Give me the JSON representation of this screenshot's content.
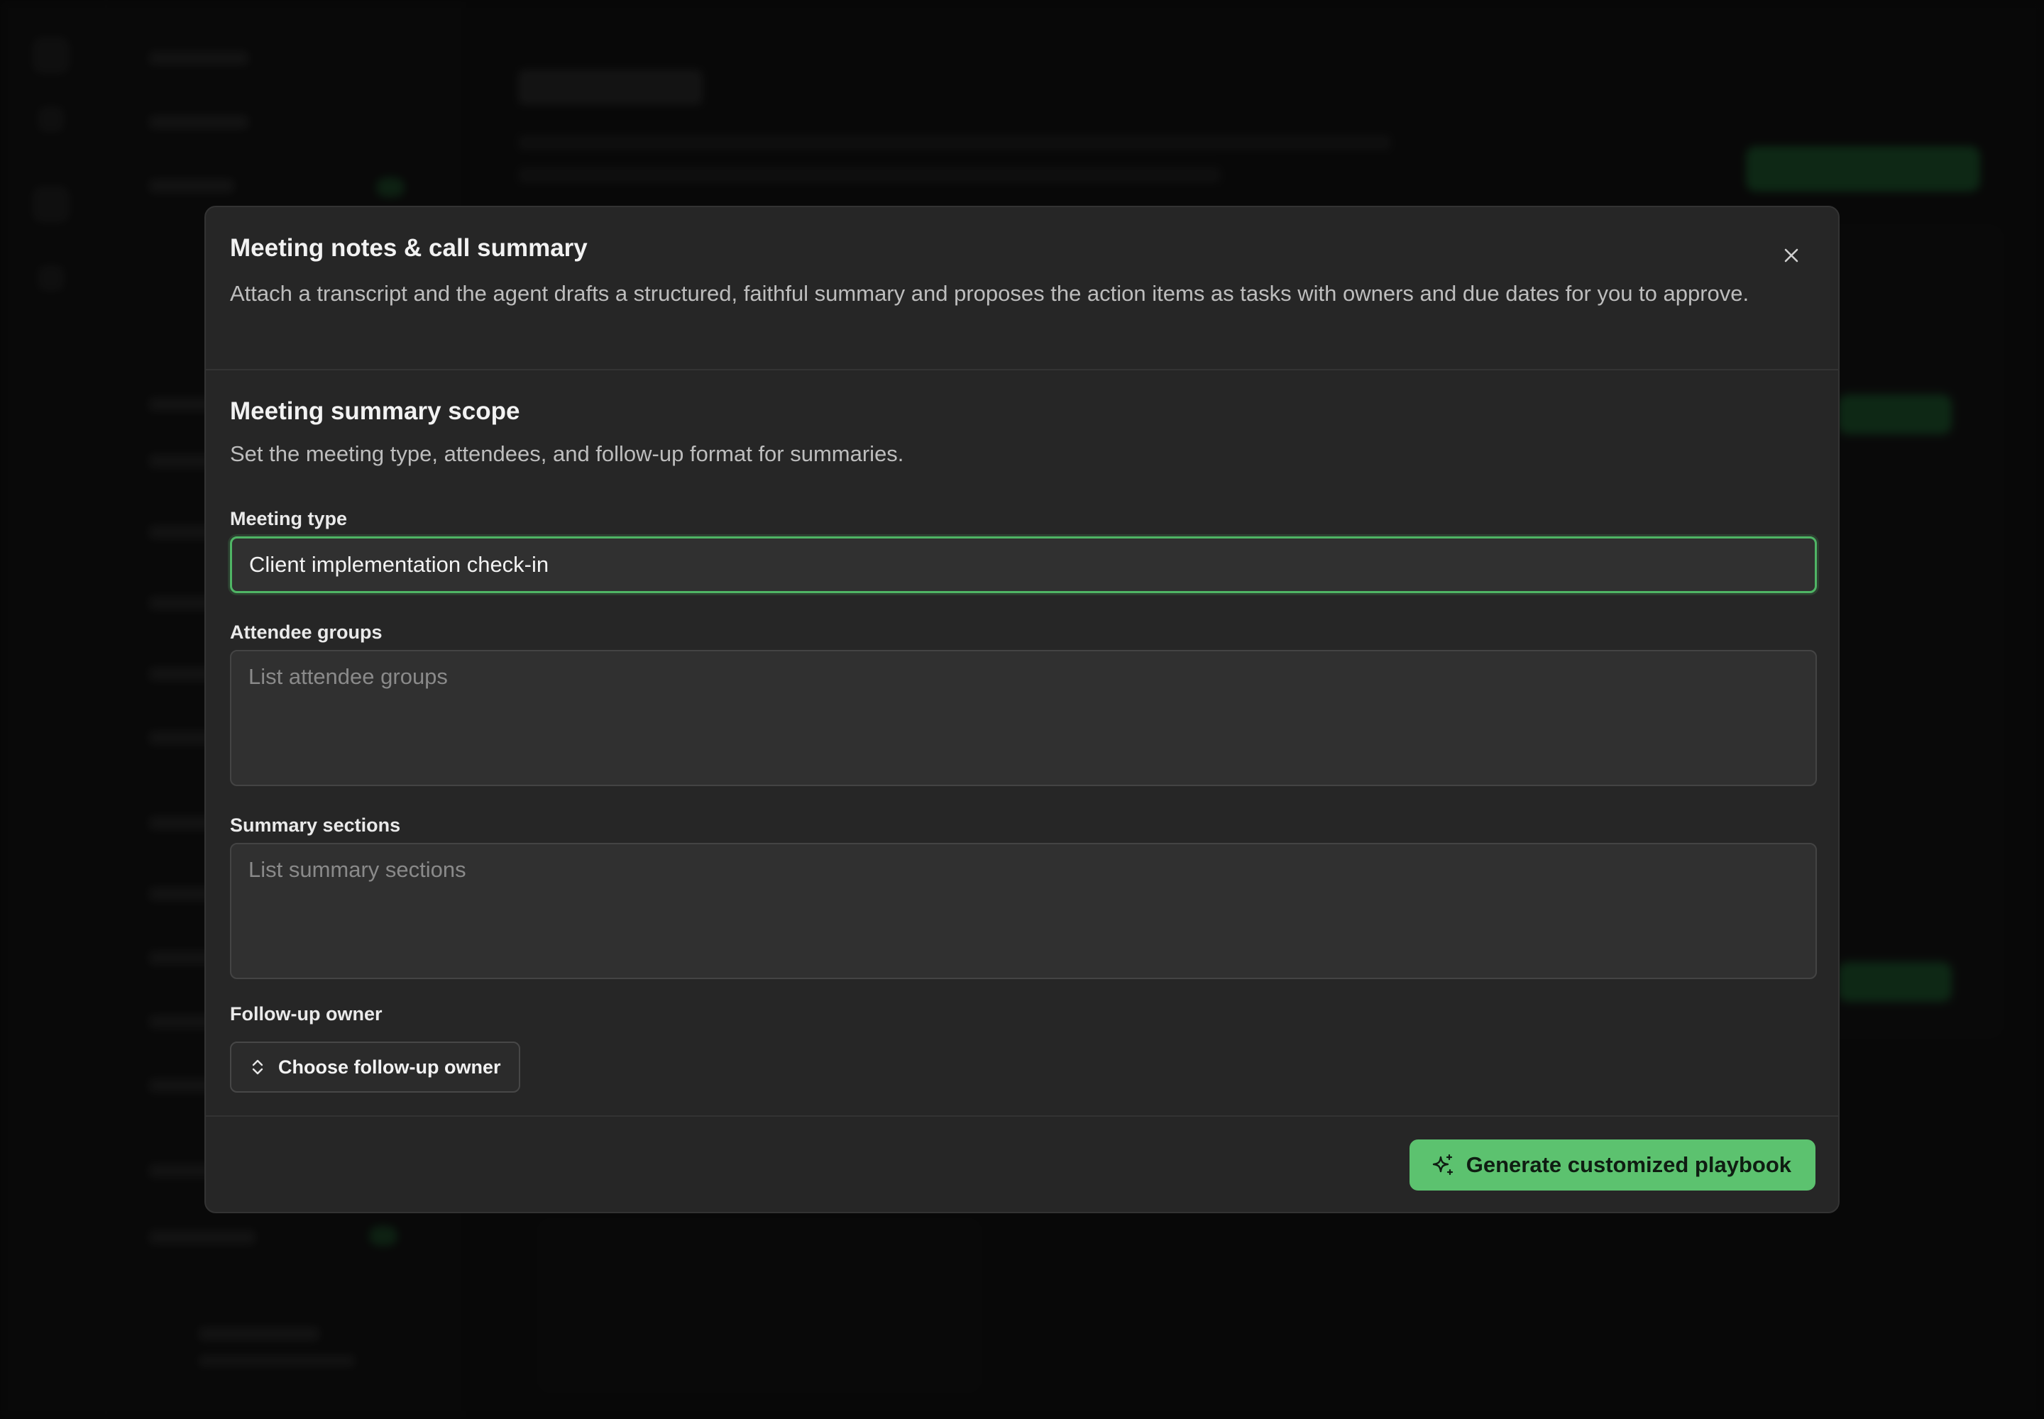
{
  "modal": {
    "title": "Meeting notes & call summary",
    "description": "Attach a transcript and the agent drafts a structured, faithful summary and proposes the action items as tasks with owners and due dates for you to approve.",
    "close_icon": "close-icon"
  },
  "section": {
    "title": "Meeting summary scope",
    "description": "Set the meeting type, attendees, and follow-up format for summaries."
  },
  "fields": {
    "meeting_type": {
      "label": "Meeting type",
      "value": "Client implementation check-in"
    },
    "attendee_groups": {
      "label": "Attendee groups",
      "placeholder": "List attendee groups"
    },
    "summary_sections": {
      "label": "Summary sections",
      "placeholder": "List summary sections"
    },
    "follow_up_owner": {
      "label": "Follow-up owner",
      "button_label": "Choose follow-up owner",
      "icon": "chevron-up-down-icon"
    }
  },
  "footer": {
    "generate_label": "Generate customized playbook",
    "generate_icon": "sparkles-icon"
  },
  "colors": {
    "accent": "#5cc26f",
    "modal_bg": "#262626",
    "overlay": "#000000"
  }
}
